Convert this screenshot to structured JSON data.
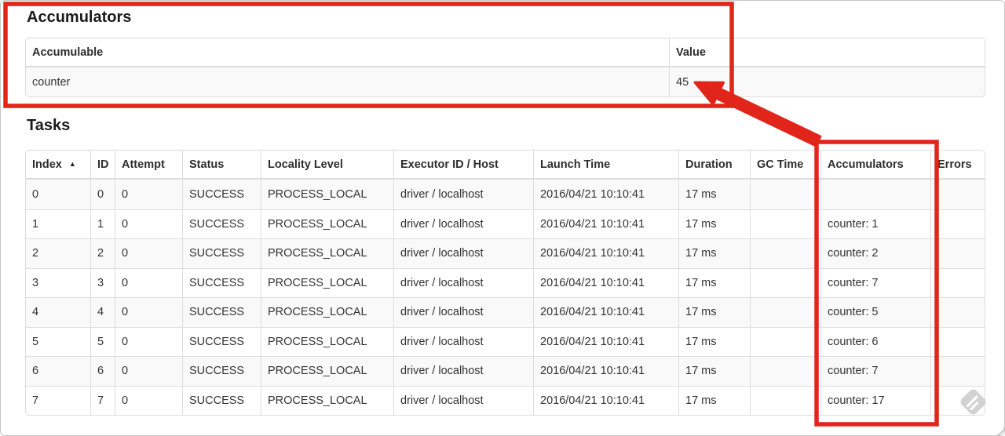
{
  "accumulators_section": {
    "title": "Accumulators",
    "table": {
      "headers": [
        "Accumulable",
        "Value"
      ],
      "rows": [
        [
          "counter",
          "45"
        ]
      ]
    }
  },
  "tasks_section": {
    "title": "Tasks",
    "table": {
      "headers": [
        "Index",
        "ID",
        "Attempt",
        "Status",
        "Locality Level",
        "Executor ID / Host",
        "Launch Time",
        "Duration",
        "GC Time",
        "Accumulators",
        "Errors"
      ],
      "sort_icon": "▲",
      "rows": [
        [
          "0",
          "0",
          "0",
          "SUCCESS",
          "PROCESS_LOCAL",
          "driver / localhost",
          "2016/04/21 10:10:41",
          "17 ms",
          "",
          "",
          ""
        ],
        [
          "1",
          "1",
          "0",
          "SUCCESS",
          "PROCESS_LOCAL",
          "driver / localhost",
          "2016/04/21 10:10:41",
          "17 ms",
          "",
          "counter: 1",
          ""
        ],
        [
          "2",
          "2",
          "0",
          "SUCCESS",
          "PROCESS_LOCAL",
          "driver / localhost",
          "2016/04/21 10:10:41",
          "17 ms",
          "",
          "counter: 2",
          ""
        ],
        [
          "3",
          "3",
          "0",
          "SUCCESS",
          "PROCESS_LOCAL",
          "driver / localhost",
          "2016/04/21 10:10:41",
          "17 ms",
          "",
          "counter: 7",
          ""
        ],
        [
          "4",
          "4",
          "0",
          "SUCCESS",
          "PROCESS_LOCAL",
          "driver / localhost",
          "2016/04/21 10:10:41",
          "17 ms",
          "",
          "counter: 5",
          ""
        ],
        [
          "5",
          "5",
          "0",
          "SUCCESS",
          "PROCESS_LOCAL",
          "driver / localhost",
          "2016/04/21 10:10:41",
          "17 ms",
          "",
          "counter: 6",
          ""
        ],
        [
          "6",
          "6",
          "0",
          "SUCCESS",
          "PROCESS_LOCAL",
          "driver / localhost",
          "2016/04/21 10:10:41",
          "17 ms",
          "",
          "counter: 7",
          ""
        ],
        [
          "7",
          "7",
          "0",
          "SUCCESS",
          "PROCESS_LOCAL",
          "driver / localhost",
          "2016/04/21 10:10:41",
          "17 ms",
          "",
          "counter: 17",
          ""
        ]
      ]
    }
  },
  "annotations": {
    "color": "#e1251b",
    "highlighted_value": "45"
  },
  "watermark": {
    "color": "#d2d2d2"
  }
}
